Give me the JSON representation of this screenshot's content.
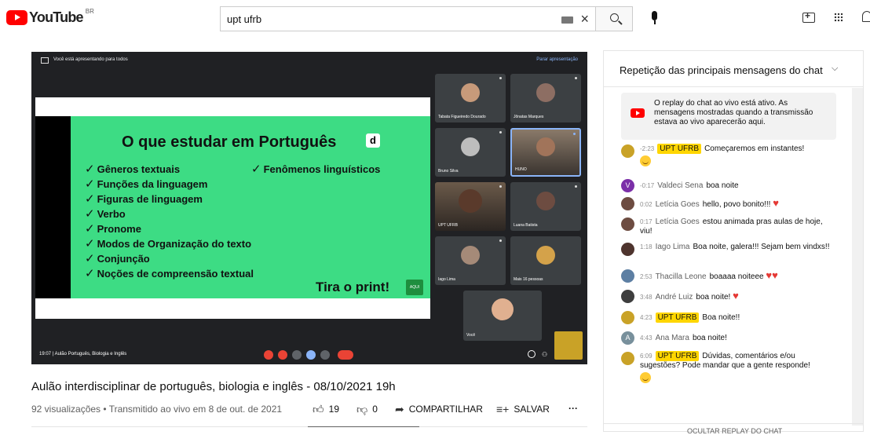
{
  "header": {
    "logo_text": "YouTube",
    "country": "BR",
    "search_value": "upt ufrb",
    "icons": [
      "youtube-logo",
      "keyboard-icon",
      "clear-icon",
      "search-icon",
      "mic-icon",
      "create-icon",
      "apps-icon",
      "notifications-icon"
    ]
  },
  "meet": {
    "presenting_text": "Você está apresentando para todos",
    "stop_presenting": "Parar apresentação",
    "bottom_time": "19:07  |  Aulão Português, Biologia e Inglês",
    "participants": [
      {
        "name": "Tabata Figueiredo Dourado"
      },
      {
        "name": "Jônatas Marques"
      },
      {
        "name": "Bruno Silva"
      },
      {
        "name": "HUNO"
      },
      {
        "name": "UPT UFRB"
      },
      {
        "name": "Luana Batista"
      },
      {
        "name": "Iago Lima"
      },
      {
        "name": "Mais 16 pessoas"
      },
      {
        "name": "Você"
      }
    ]
  },
  "slide": {
    "title": "O que estudar em Português",
    "d_badge": "d",
    "topics": [
      "Gêneros textuais",
      "Funções da linguagem",
      "Figuras de linguagem",
      "Verbo",
      "Pronome",
      "Modos de Organização do texto",
      "Conjunção",
      "Noções de compreensão textual"
    ],
    "topic_right": "Fenômenos linguísticos",
    "print_text": "Tira o print!",
    "badge_text": "AQUI"
  },
  "video": {
    "title": "Aulão interdisciplinar de português, biologia e inglês - 08/10/2021 19h",
    "meta": "92 visualizações • Transmitido ao vivo em 8 de out. de 2021",
    "likes": "19",
    "dislikes": "0",
    "share_label": "COMPARTILHAR",
    "save_label": "SALVAR",
    "more_label": "···"
  },
  "chat": {
    "header": "Repetição das principais mensagens do chat",
    "notice": "O replay do chat ao vivo está ativo. As mensagens mostradas quando a transmissão estava ao vivo aparecerão aqui.",
    "hide_label": "OCULTAR REPLAY DO CHAT",
    "messages": [
      {
        "time": "-2:23",
        "author": "UPT UFRB",
        "owner": true,
        "text": "Começaremos em instantes!",
        "emoji": "smile",
        "avatar_color": "#c9a227"
      },
      {
        "time": "-0:17",
        "author": "Valdeci Sena",
        "owner": false,
        "text": "boa noite",
        "avatar_letter": "V",
        "avatar_color": "#7b2fa8"
      },
      {
        "time": "0:02",
        "author": "Letícia Goes",
        "owner": false,
        "text": "hello, povo bonito!!!",
        "emoji": "heart",
        "avatar_color": "#6d4c41"
      },
      {
        "time": "0:17",
        "author": "Letícia Goes",
        "owner": false,
        "text": "estou animada pras aulas de hoje, viu!",
        "avatar_color": "#6d4c41"
      },
      {
        "time": "1:18",
        "author": "Iago Lima",
        "owner": false,
        "text": "Boa noite, galera!!! Sejam bem vindxs!!",
        "avatar_color": "#4e342e"
      },
      {
        "time": "2:53",
        "author": "Thacilla Leone",
        "owner": false,
        "text": "boaaaa noiteee",
        "emoji": "heart2",
        "avatar_color": "#5d7fa3"
      },
      {
        "time": "3:48",
        "author": "André Luiz",
        "owner": false,
        "text": "boa noite!",
        "emoji": "heart",
        "avatar_color": "#3e3e3e"
      },
      {
        "time": "4:23",
        "author": "UPT UFRB",
        "owner": true,
        "text": "Boa noite!!",
        "avatar_color": "#c9a227"
      },
      {
        "time": "4:43",
        "author": "Ana Mara",
        "owner": false,
        "text": "boa noite!",
        "avatar_letter": "A",
        "avatar_color": "#78909c"
      },
      {
        "time": "6:09",
        "author": "UPT UFRB",
        "owner": true,
        "text": "Dúvidas, comentários e/ou sugestões? Pode mandar que a gente responde!",
        "emoji": "smile",
        "avatar_color": "#c9a227"
      }
    ]
  }
}
